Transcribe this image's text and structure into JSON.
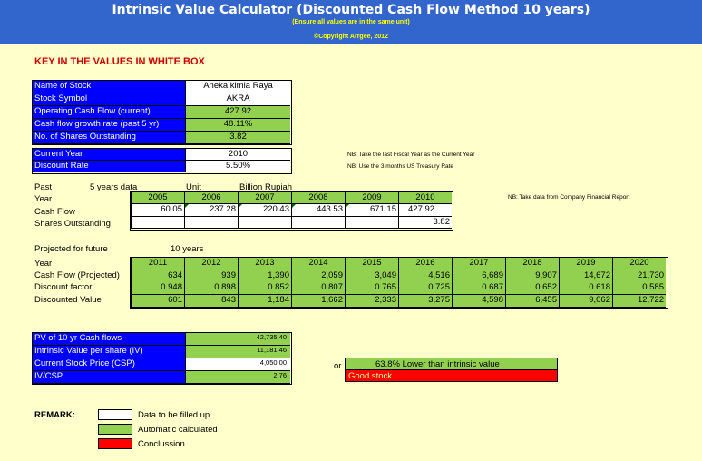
{
  "header": {
    "title": "Intrinsic Value Calculator (Discounted Cash Flow Method 10 years)",
    "subtitle": "(Ensure all values are in the same unit)",
    "copyright": "©Copyright Arrgee, 2012"
  },
  "instruction": "KEY IN THE VALUES IN WHITE BOX",
  "stock_info": [
    {
      "label": "Name of Stock",
      "value": "Aneka kimia Raya",
      "kind": "white"
    },
    {
      "label": "Stock Symbol",
      "value": "AKRA",
      "kind": "white"
    },
    {
      "label": "Operating Cash Flow (current)",
      "value": "427.92",
      "kind": "green"
    },
    {
      "label": "Cash flow growth rate (past 5 yr)",
      "value": "48.11%",
      "kind": "green"
    },
    {
      "label": "No. of Shares Outstanding",
      "value": "3.82",
      "kind": "green"
    }
  ],
  "rates": [
    {
      "label": "Current Year",
      "value": "2010",
      "kind": "white"
    },
    {
      "label": "Discount Rate",
      "value": "5.50%",
      "kind": "white"
    }
  ],
  "notes": {
    "fiscal_year": "NB: Take the last Fiscal Year as the Current Year",
    "treasury": "NB: Use the 3 months US Treasury Rate",
    "financial_report": "NB: Take data from Company Financial Report"
  },
  "past": {
    "label": "Past",
    "years_data": "5 years data",
    "unit_label": "Unit",
    "unit_value": "Billion Rupiah",
    "row_labels": [
      "Year",
      "Cash Flow",
      "Shares Outstanding"
    ],
    "years": [
      "2005",
      "2006",
      "2007",
      "2008",
      "2009",
      "2010"
    ],
    "cash_flow": [
      "60.05",
      "237.28",
      "220.43",
      "443.53",
      "671.15",
      "427.92"
    ],
    "shares": [
      "",
      "",
      "",
      "",
      "",
      "3.82"
    ]
  },
  "projected": {
    "label": "Projected for future",
    "years_label": "10 years",
    "row_labels": [
      "Year",
      "Cash Flow (Projected)",
      "Discount factor",
      "Discounted Value"
    ],
    "years": [
      "2011",
      "2012",
      "2013",
      "2014",
      "2015",
      "2016",
      "2017",
      "2018",
      "2019",
      "2020"
    ],
    "cash_flow": [
      "634",
      "939",
      "1,390",
      "2,059",
      "3,049",
      "4,516",
      "6,689",
      "9,907",
      "14,672",
      "21,730"
    ],
    "discount_factor": [
      "0.948",
      "0.898",
      "0.852",
      "0.807",
      "0.765",
      "0.725",
      "0.687",
      "0.652",
      "0.618",
      "0.585"
    ],
    "discounted_value": [
      "601",
      "843",
      "1,184",
      "1,662",
      "2,333",
      "3,275",
      "4,598",
      "6,455",
      "9,062",
      "12,722"
    ]
  },
  "summary": [
    {
      "label": "PV of 10 yr Cash flows",
      "value": "42,735.40",
      "kind": "green"
    },
    {
      "label": "Intrinsic Value per share (IV)",
      "value": "11,181.46",
      "kind": "green"
    },
    {
      "label": "Current Stock Price (CSP)",
      "value": "4,050.00",
      "kind": "white"
    },
    {
      "label": "IV/CSP",
      "value": "2.76",
      "kind": "green"
    }
  ],
  "result": {
    "or": "or",
    "lower_text": "63.8%  Lower than intrinsic value",
    "verdict": "Good stock"
  },
  "remark": {
    "label": "REMARK:",
    "items": [
      {
        "text": "Data to be filled up",
        "color": "#ffffff"
      },
      {
        "text": "Automatic calculated",
        "color": "#92d050"
      },
      {
        "text": "Conclussion",
        "color": "#ff0000"
      }
    ]
  },
  "colors": {
    "header": "#3366cc",
    "label_blue": "#0000ff",
    "input_white": "#ffffff",
    "auto_green": "#92d050",
    "conclusion_red": "#ff0000",
    "background": "#ffffcc"
  }
}
